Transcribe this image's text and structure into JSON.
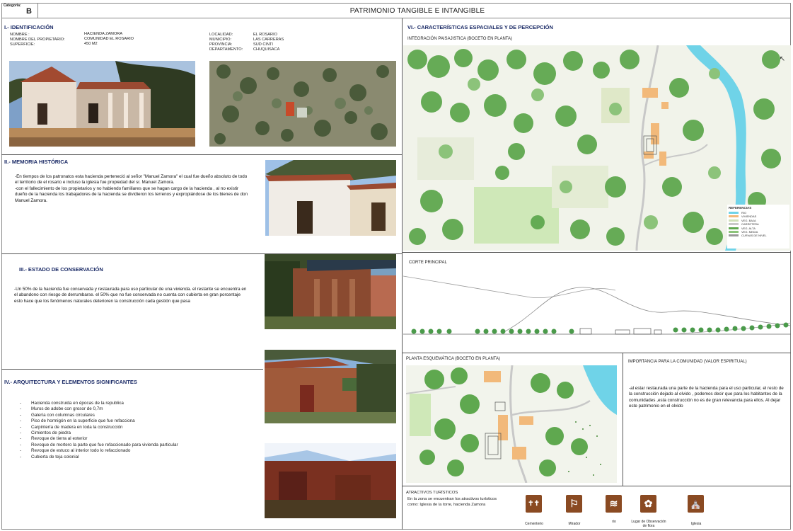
{
  "header": {
    "category_label": "Categoria:",
    "category_value": "B",
    "title": "PATRIMONIO TANGIBLE E INTANGIBLE"
  },
  "identificacion": {
    "title": "I.- IDENTIFICACIÓN",
    "left": [
      {
        "label": "NOMBRE :",
        "value": "HACIENDA ZAMORA"
      },
      {
        "label": "NOMBRE DEL PROPIETARIO:",
        "value": "COMUNIDAD EL ROSARIO"
      },
      {
        "label": "SUPERFICIE:",
        "value": "450 M2"
      }
    ],
    "right": [
      {
        "label": "LOCALIDAD:",
        "value": "EL ROSARIO"
      },
      {
        "label": "MUNICIPIO:",
        "value": "LAS CARRERAS"
      },
      {
        "label": "PROVINCIA:",
        "value": "SUD CINTI"
      },
      {
        "label": "DEPARTAMENTO:",
        "value": "CHUQUISACA"
      }
    ]
  },
  "memoria": {
    "title": "II.- MEMORIA HISTÓRICA",
    "p1": "-En tiempos de los patronatos esta hacienda perteneció al señor \"Manuel Zamora\"  el cual fue dueño absoluto de todo el territorio de el rosario e incluso la iglesia fue propiedad del sr. Manuel Zamora.",
    "p2": "-con el fallecimiento de los propietarios y no habiendo familiares que se hagan cargo de la hacienda , al no existir dueño de la hacienda los trabajadores de la hacienda se dividieron los terrenos y expropiándose de los bienes de don Manuel Zamora."
  },
  "estado": {
    "title": "III.- ESTADO DE CONSERVACIÓN",
    "text": "-Un 50% de la hacienda fue conservada y restaurada para uso particular  de una vivienda. el restante se encuentra en el abandono con riesgo de derrumbarse. el 50% que no fue conservada no cuenta con cubierta en gran porcentaje esto hace que los fenómenos naturales deterioren la construcción cada gestión que pasa"
  },
  "arquitectura": {
    "title": "IV.- ARQUITECTURA Y ELEMENTOS  SIGNIFICANTES",
    "items": [
      "Hacienda construida en épocas de la republica",
      "Muros de adobe con grosor de 0,7m",
      "Galería con columnas circulares",
      "Piso de hormigón en la superficie que fue refacciona",
      "Carpintería de madera en toda la construcción",
      "Cimientos de piedra",
      "Revoque de tierra al exterior",
      "Revoque de mortero la parte que fue refaccionado para vivienda particular",
      "Revoque de estuco al interior todo  lo refaccionado",
      "Cubierta de teja colonial"
    ]
  },
  "caracteristicas": {
    "title": "VI.- CARACTERÍSTICAS ESPACIALES Y DE PERCEPCIÓN",
    "subtitle": "INTEGRACIÓN PAISAJISTICA  (BOCETO EN PLANTA)",
    "legend_title": "REFERENCIAS",
    "legend": [
      "RIO",
      "VIVIENDAS",
      "VEG. BAJA",
      "CARRETERA",
      "VEG. ALTA",
      "VEG. MEDIA",
      "CURVAS DE NIVEL"
    ],
    "legend_colors": [
      "#6fd3e8",
      "#f2b97a",
      "#cfe0b8",
      "#c8c8c8",
      "#5fa84f",
      "#8cc37a",
      "#999999"
    ]
  },
  "corte": {
    "title": "CORTE PRINCIPAL"
  },
  "planta": {
    "title": "PLANTA ESQUEMÁTICA (BOCETO EN PLANTA)"
  },
  "importancia": {
    "title": "IMPORTANCIA PARA LA COMUNIDAD (VALOR ESPIRITUAL)",
    "text": "-al  estar restaurada una parte de la hacienda para el uso particular, el resto de la construcción dejado al olvido , podemos decir que para los habitantes de la comunidades ,esta construcción no es de gran relevancia para ellos. Al dejar este patrimonio en el olvido"
  },
  "atractivos": {
    "title": "ATRACTIVOS TURÍSTICOS",
    "text": "En la zona se encuentran los atractivos turísticos como: Iglesia de la torre, hacienda Zamora",
    "icons": [
      {
        "label": "Cementerio",
        "glyph": "✝✝",
        "icon": "cemetery-icon"
      },
      {
        "label": "Mirador",
        "glyph": "⚐",
        "icon": "viewpoint-icon"
      },
      {
        "label": "rio",
        "glyph": "≋",
        "icon": "river-icon"
      },
      {
        "label": "Lugar de Observación de flora",
        "glyph": "✿",
        "icon": "flora-icon"
      },
      {
        "label": "Iglesia",
        "glyph": "⛪",
        "icon": "church-icon"
      }
    ]
  },
  "colors": {
    "section_title": "#1a2a66",
    "icon_bg": "#8a4a22",
    "map_green": "#5fa84f",
    "river": "#6fd3e8"
  }
}
